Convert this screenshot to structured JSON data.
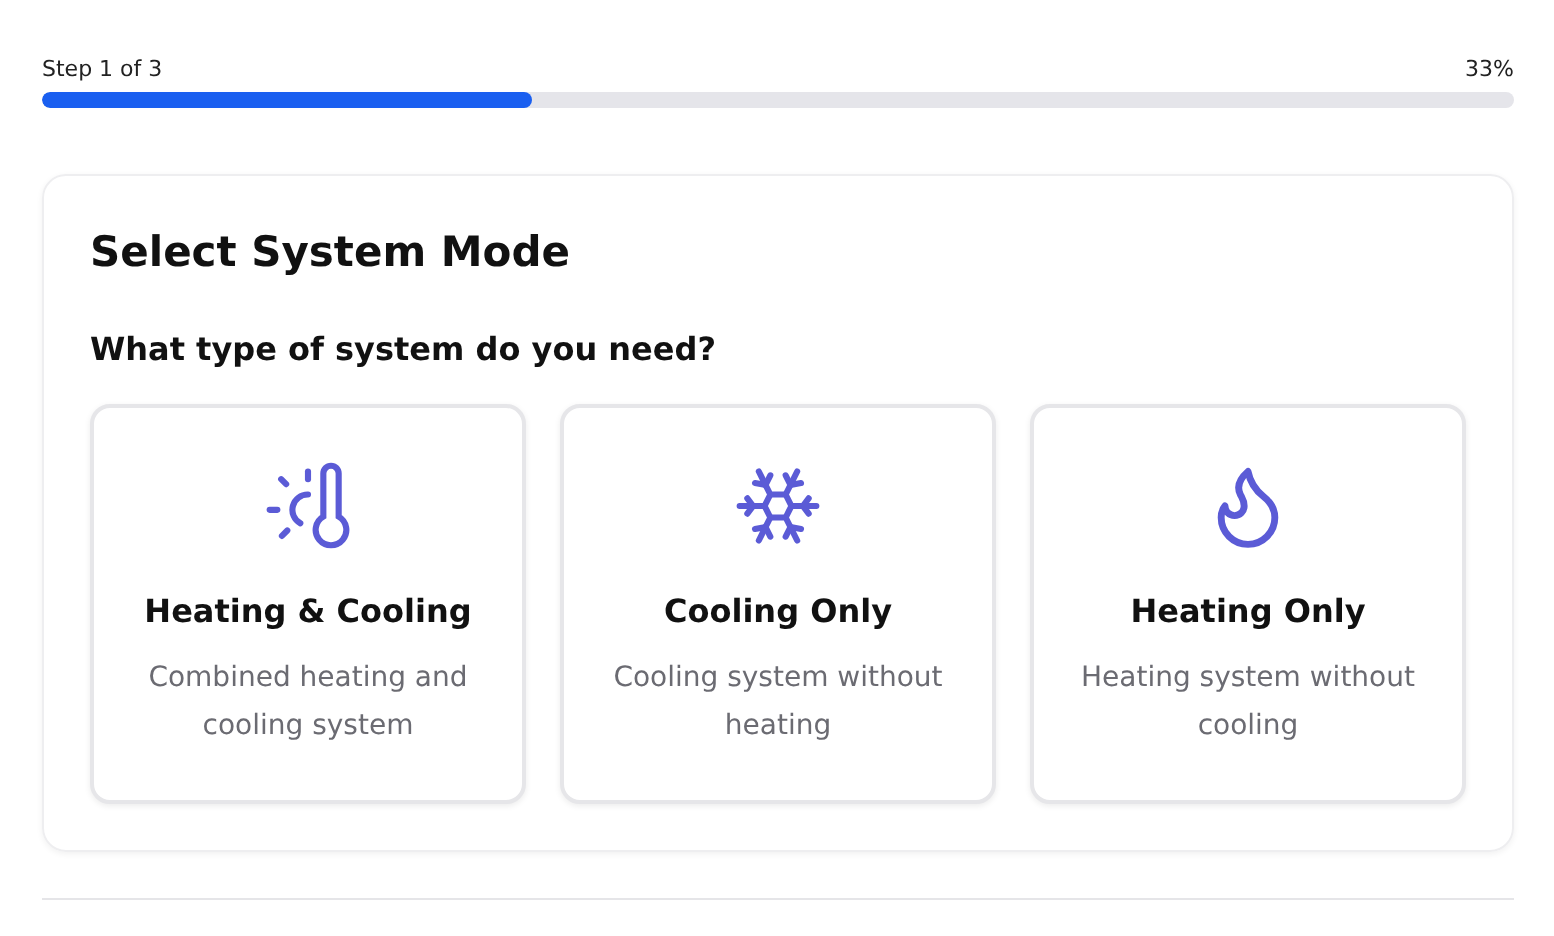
{
  "progress": {
    "step_label": "Step 1 of 3",
    "percent_label": "33%",
    "level": 0.333
  },
  "card": {
    "title": "Select System Mode",
    "question": "What type of system do you need?",
    "options": [
      {
        "kind": "both",
        "title": "Heating & Cooling",
        "description": "Combined heating and cooling system"
      },
      {
        "kind": "cool",
        "title": "Cooling Only",
        "description": "Cooling system without heating"
      },
      {
        "kind": "heat",
        "title": "Heating Only",
        "description": "Heating system without cooling"
      }
    ]
  }
}
